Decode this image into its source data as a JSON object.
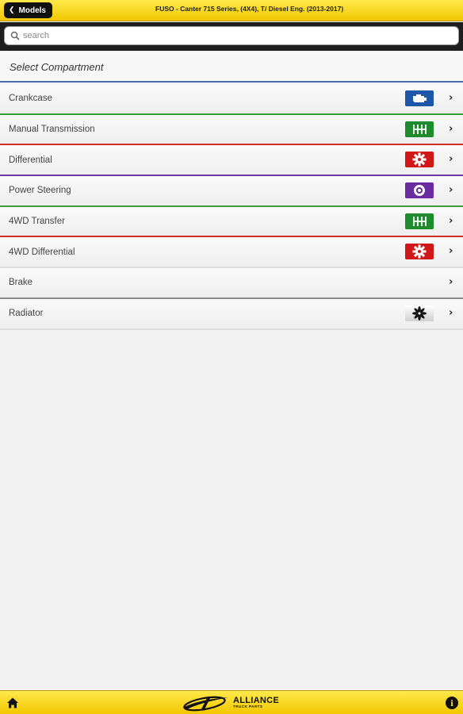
{
  "header": {
    "back_label": "Models",
    "title": "FUSO - Canter 715 Series, (4X4), T/ Diesel Eng. (2013-2017)"
  },
  "search": {
    "placeholder": "search",
    "value": ""
  },
  "section": {
    "title": "Select Compartment"
  },
  "compartments": [
    {
      "label": "Crankcase",
      "icon": "engine-icon",
      "icon_bg": "#1e57a8",
      "divider": "#3a9a3a"
    },
    {
      "label": "Manual Transmission",
      "icon": "gearbox-icon",
      "icon_bg": "#1f8a2e",
      "divider": "#d03030"
    },
    {
      "label": "Differential",
      "icon": "gear-icon",
      "icon_bg": "#d01818",
      "divider": "#6a3aa8"
    },
    {
      "label": "Power Steering",
      "icon": "steering-pump-icon",
      "icon_bg": "#6a2aa0",
      "divider": "#3a9a3a"
    },
    {
      "label": "4WD Transfer",
      "icon": "gearbox-icon",
      "icon_bg": "#1f8a2e",
      "divider": "#d03030"
    },
    {
      "label": "4WD Differential",
      "icon": "gear-icon",
      "icon_bg": "#d01818",
      "divider": "#dddddd"
    },
    {
      "label": "Brake",
      "icon": "",
      "icon_bg": "",
      "divider": "#888888"
    },
    {
      "label": "Radiator",
      "icon": "fan-icon",
      "icon_bg": "#e8e8e8",
      "divider": "#dddddd"
    }
  ],
  "footer": {
    "brand_name": "ALLIANCE",
    "brand_sub": "TRUCK PARTS",
    "info_label": "i"
  },
  "colors": {
    "bar_yellow": "#f5cf00",
    "section_rule": "#4a6fb5"
  }
}
